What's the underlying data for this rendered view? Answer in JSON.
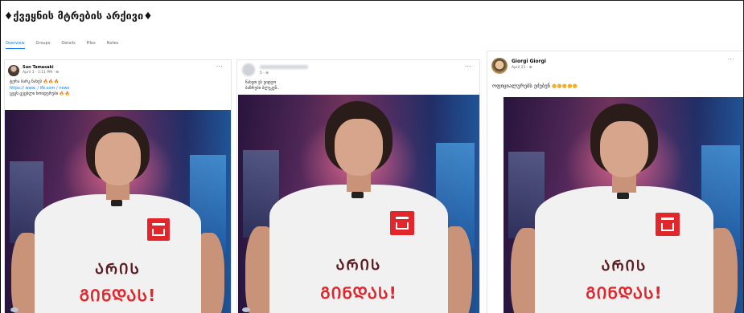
{
  "headline": "♦ქვეყნის მტრების არქივი♦",
  "tabs": [
    "Overview",
    "Groups",
    "Details",
    "Files",
    "Notes"
  ],
  "posts": [
    {
      "author": "Sun Tamasaki",
      "meta": "April 1 · 1:11 PM · ⊕",
      "lines": [
        "ტერა ბარკ ნახეს ",
        "https:// www. / ifb.com / news",
        "ცეცხ ცეცხლი ხოიდერები "
      ],
      "emoji_red_1": "🔥🔥🔥",
      "emoji_red_2": "🔥🔥",
      "menu": "···"
    },
    {
      "author": "",
      "meta": "5 · ⊕",
      "lines": [
        "ნახეთ ეს ვიდეო",
        "ბაზრები ბლეკენ.."
      ],
      "menu": "···"
    },
    {
      "author": "Giorgi Giorgi",
      "meta": "April 21 · ⊕",
      "text": "ოფიციალურებს ეძებენ",
      "emoji_yel": "●●●●●",
      "menu": "···"
    }
  ],
  "shirt_line_1": "ᲐᲠᲘᲡ",
  "shirt_line_2": "ᲒᲘᲜᲓᲐᲡ!"
}
